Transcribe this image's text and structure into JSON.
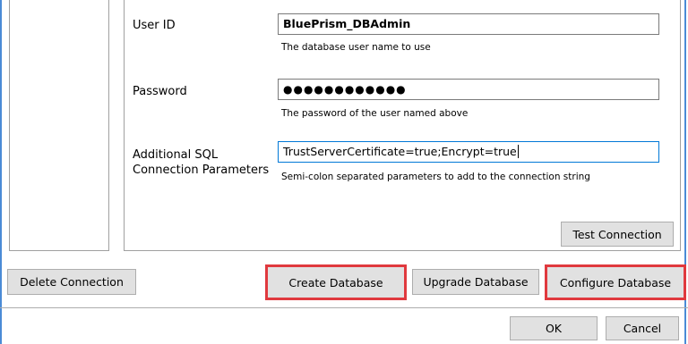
{
  "form": {
    "user_id": {
      "label": "User ID",
      "value": "BluePrism_DBAdmin",
      "hint": "The database user name to use"
    },
    "password": {
      "label": "Password",
      "value": "●●●●●●●●●●●●",
      "hint": "The password of the user named above"
    },
    "additional_params": {
      "label_line1": "Additional SQL",
      "label_line2": "Connection Parameters",
      "value": "TrustServerCertificate=true;Encrypt=true",
      "hint": "Semi-colon separated parameters to add to the connection string"
    },
    "test_connection_label": "Test Connection"
  },
  "actions": {
    "delete_connection": "Delete Connection",
    "create_database": "Create Database",
    "upgrade_database": "Upgrade Database",
    "configure_database": "Configure Database"
  },
  "dialog": {
    "ok": "OK",
    "cancel": "Cancel"
  },
  "colors": {
    "highlight": "#e0393e",
    "frame_accent": "#4a8bd6",
    "button_face": "#e1e1e1",
    "focus_border": "#0078d7"
  }
}
